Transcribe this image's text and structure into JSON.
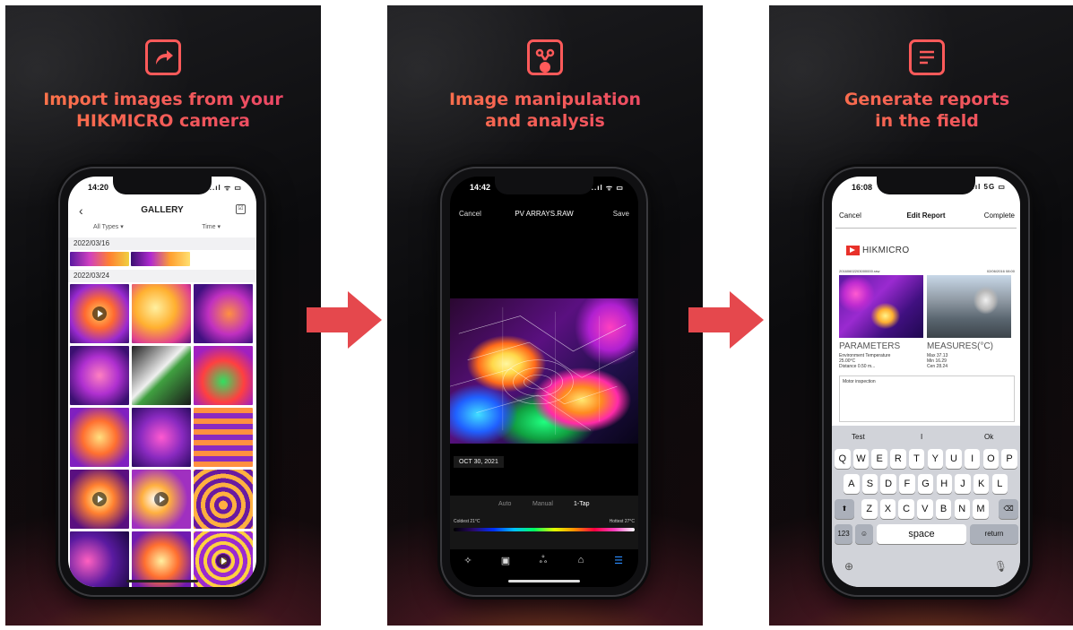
{
  "panels": [
    {
      "headline_line1": "Import images from your",
      "headline_line2": "HIKMICRO camera"
    },
    {
      "headline_line1": "Image manipulation",
      "headline_line2": "and analysis"
    },
    {
      "headline_line1": "Generate reports",
      "headline_line2": "in the field"
    }
  ],
  "gallery": {
    "time": "14:20",
    "status": "..ıl ᯤ ▭",
    "back": "‹",
    "title": "GALLERY",
    "select_icon": "☑",
    "filter_types": "All Types ▾",
    "filter_time": "Time ▾",
    "date_1": "2022/03/16",
    "date_2": "2022/03/24"
  },
  "analysis": {
    "time": "14:42",
    "status": "..ıl ᯤ ▭",
    "cancel": "Cancel",
    "title": "PV ARRAYS.RAW",
    "save": "Save",
    "date": "OCT 30, 2021",
    "mode_auto": "Auto",
    "mode_manual": "Manual",
    "mode_tap": "1-Tap",
    "coldest": "Coldest 21°C",
    "hottest": "Hottest 27°C",
    "tools": [
      "✧",
      "▣",
      "ஃ",
      "⌂",
      "☰"
    ]
  },
  "report": {
    "time": "16:08",
    "status": "..ıl 5G ▭",
    "cancel": "Cancel",
    "title": "Edit Report",
    "complete": "Complete",
    "logo": "HIKMICRO",
    "file": "20160602203000000.raw",
    "file_date": "02/06/2016 08:00",
    "params_title": "PARAMETERS",
    "measures_title": "MEASURES(°C)",
    "env_label": "Environment Temperature",
    "env_value": "25.00°C",
    "distance": "Distance   0.50 m...",
    "max": "Max   37.13",
    "min": "Min   16.29",
    "cen": "Cen   28.24",
    "notes": "Motor inspection",
    "suggestions": [
      "Test",
      "I",
      "Ok"
    ],
    "keys_row1": [
      "Q",
      "W",
      "E",
      "R",
      "T",
      "Y",
      "U",
      "I",
      "O",
      "P"
    ],
    "keys_row2": [
      "A",
      "S",
      "D",
      "F",
      "G",
      "H",
      "J",
      "K",
      "L"
    ],
    "keys_row3": [
      "Z",
      "X",
      "C",
      "V",
      "B",
      "N",
      "M"
    ],
    "shift": "⬆",
    "delete": "⌫",
    "num_key": "123",
    "emoji_key": "☺",
    "space": "space",
    "return": "return",
    "globe": "⊕",
    "mic": "🎙"
  },
  "colors": {
    "accent_orange": "#ff7a45",
    "accent_pink": "#e8406a",
    "arrow_red": "#e5484d",
    "ios_blue": "#2a8cff"
  }
}
